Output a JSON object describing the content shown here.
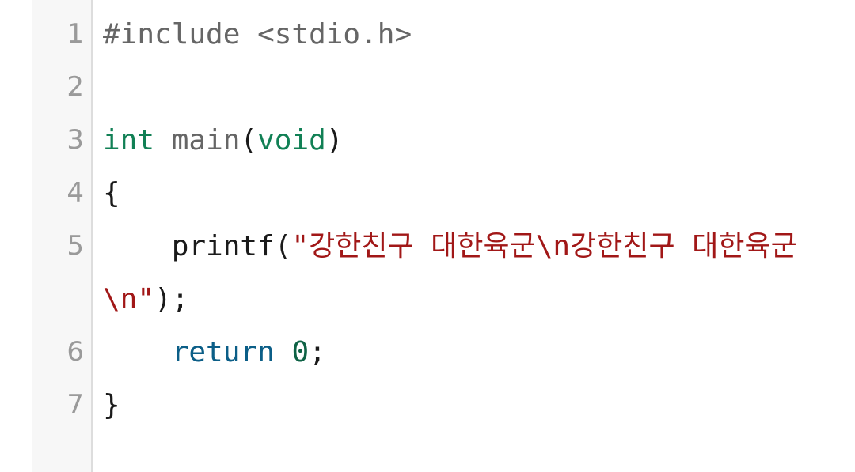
{
  "code": {
    "line_numbers": [
      "1",
      "2",
      "3",
      "4",
      "5",
      "6",
      "7"
    ],
    "line1": {
      "directive": "#include <stdio.h>"
    },
    "line3": {
      "type": "int",
      "space": " ",
      "name": "main",
      "open": "(",
      "param": "void",
      "close": ")"
    },
    "line4": {
      "text": "{"
    },
    "line5": {
      "indent": "    ",
      "fn": "printf",
      "open": "(",
      "string": "\"강한친구 대한육군\\n강한친구 대한육군\\n\"",
      "close": ");"
    },
    "line6": {
      "indent": "    ",
      "keyword": "return",
      "space": " ",
      "number": "0",
      "semi": ";"
    },
    "line7": {
      "text": "}"
    }
  },
  "colors": {
    "preprocessor": "#666666",
    "type": "#118055",
    "keyword": "#0b5e87",
    "number": "#0e6245",
    "string": "#a11717",
    "line_number": "#9a9a9a",
    "gutter_bg": "#f7f7f7"
  }
}
